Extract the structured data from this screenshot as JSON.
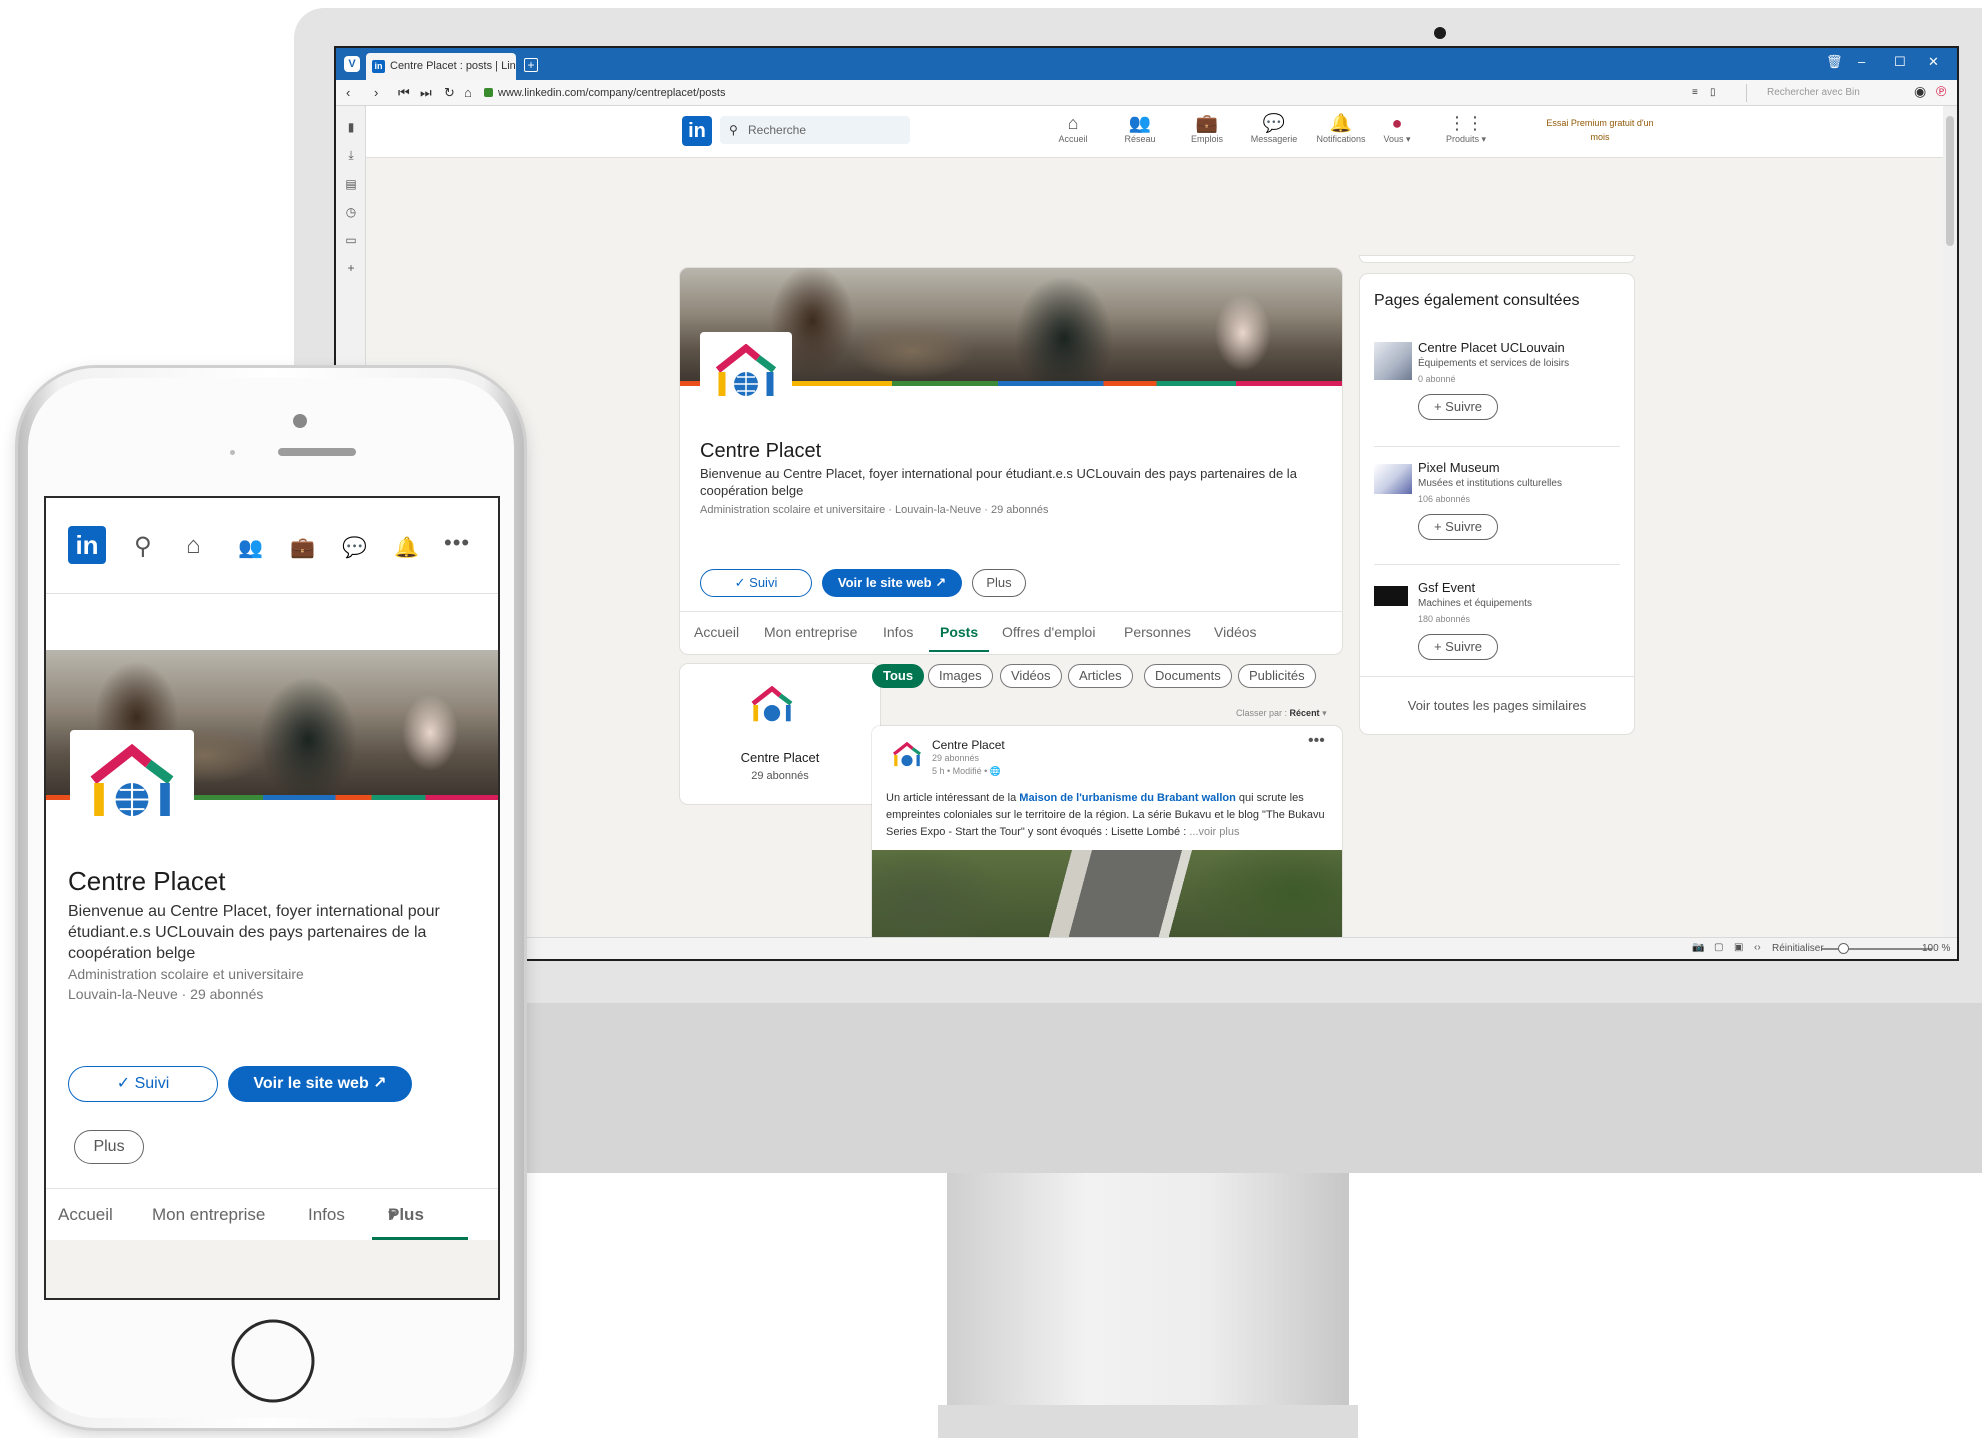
{
  "browser": {
    "tab_title": "Centre Placet : posts | LinkedIn",
    "url": "www.linkedin.com/company/centreplacet/posts",
    "search_placeholder": "Rechercher avec Bin",
    "status_reset": "Réinitialiser",
    "zoom": "100 %"
  },
  "nav": {
    "search_placeholder": "Recherche",
    "items": [
      "Accueil",
      "Réseau",
      "Emplois",
      "Messagerie",
      "Notifications",
      "Vous",
      "Produits"
    ],
    "premium": "Essai Premium gratuit d'un mois"
  },
  "company": {
    "name": "Centre Placet",
    "description": "Bienvenue au Centre Placet, foyer international pour étudiant.e.s UCLouvain des pays partenaires de la coopération belge",
    "meta": "Administration scolaire et universitaire · Louvain-la-Neuve · 29 abonnés",
    "meta_line1": "Administration scolaire et universitaire",
    "meta_line2": "Louvain-la-Neuve · 29 abonnés",
    "followers": "29 abonnés"
  },
  "buttons": {
    "followed": "✓ Suivi",
    "website": "Voir le site web",
    "more": "Plus"
  },
  "tabs": [
    "Accueil",
    "Mon entreprise",
    "Infos",
    "Posts",
    "Offres d'emploi",
    "Personnes",
    "Vidéos"
  ],
  "active_tab": "Posts",
  "filters": [
    "Tous",
    "Images",
    "Vidéos",
    "Articles",
    "Documents",
    "Publicités"
  ],
  "sort": {
    "label": "Classer par :",
    "value": "Récent"
  },
  "post": {
    "author": "Centre Placet",
    "followers": "29 abonnés",
    "time": "5 h • Modifié •",
    "text_before": "Un article intéressant de la ",
    "link": "Maison de l'urbanisme du Brabant wallon",
    "text_after": " qui scrute les empreintes coloniales sur le territoire de la région. La série Bukavu et le blog \"The Bukavu Series Expo - Start the Tour\" y sont évoqués : Lisette Lombé :",
    "see_more": "...voir plus"
  },
  "similar": {
    "title": "Pages également consultées",
    "follow": "+ Suivre",
    "see_all": "Voir toutes les pages similaires",
    "items": [
      {
        "name": "Centre Placet UCLouvain",
        "category": "Équipements et services de loisirs",
        "followers": "0 abonné"
      },
      {
        "name": "Pixel Museum",
        "category": "Musées et institutions culturelles",
        "followers": "106 abonnés"
      },
      {
        "name": "Gsf Event",
        "category": "Machines et équipements",
        "followers": "180 abonnés"
      }
    ]
  },
  "mobile": {
    "tabs": [
      "Accueil",
      "Mon entreprise",
      "Infos",
      "Plus"
    ]
  },
  "colors": {
    "linkedin_blue": "#0a66c2",
    "active_green": "#01754f",
    "vivaldi_blue": "#1b67b4",
    "page_bg": "#f3f2ef"
  }
}
